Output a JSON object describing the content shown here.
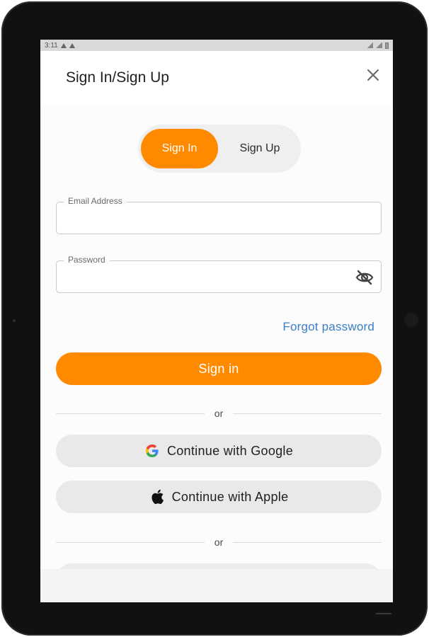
{
  "status_bar": {
    "time": "3:11"
  },
  "header": {
    "title": "Sign In/Sign Up"
  },
  "toggle": {
    "active_label": "Sign In",
    "inactive_label": "Sign Up"
  },
  "email_field": {
    "label": "Email Address",
    "value": "",
    "placeholder": ""
  },
  "password_field": {
    "label": "Password",
    "value": "",
    "placeholder": ""
  },
  "forgot_password": "Forgot password",
  "sign_in_button": "Sign in",
  "divider_text": "or",
  "google_button": "Continue with Google",
  "apple_button": "Continue with Apple",
  "divider_text_2": "or",
  "colors": {
    "accent": "#FF8A00",
    "link": "#3B7EC7",
    "social_bg": "#E9E9E9"
  },
  "icons": [
    "warning-icon",
    "wifi-icon",
    "battery-icon",
    "close-icon",
    "eye-off-icon",
    "google-icon",
    "apple-icon"
  ]
}
